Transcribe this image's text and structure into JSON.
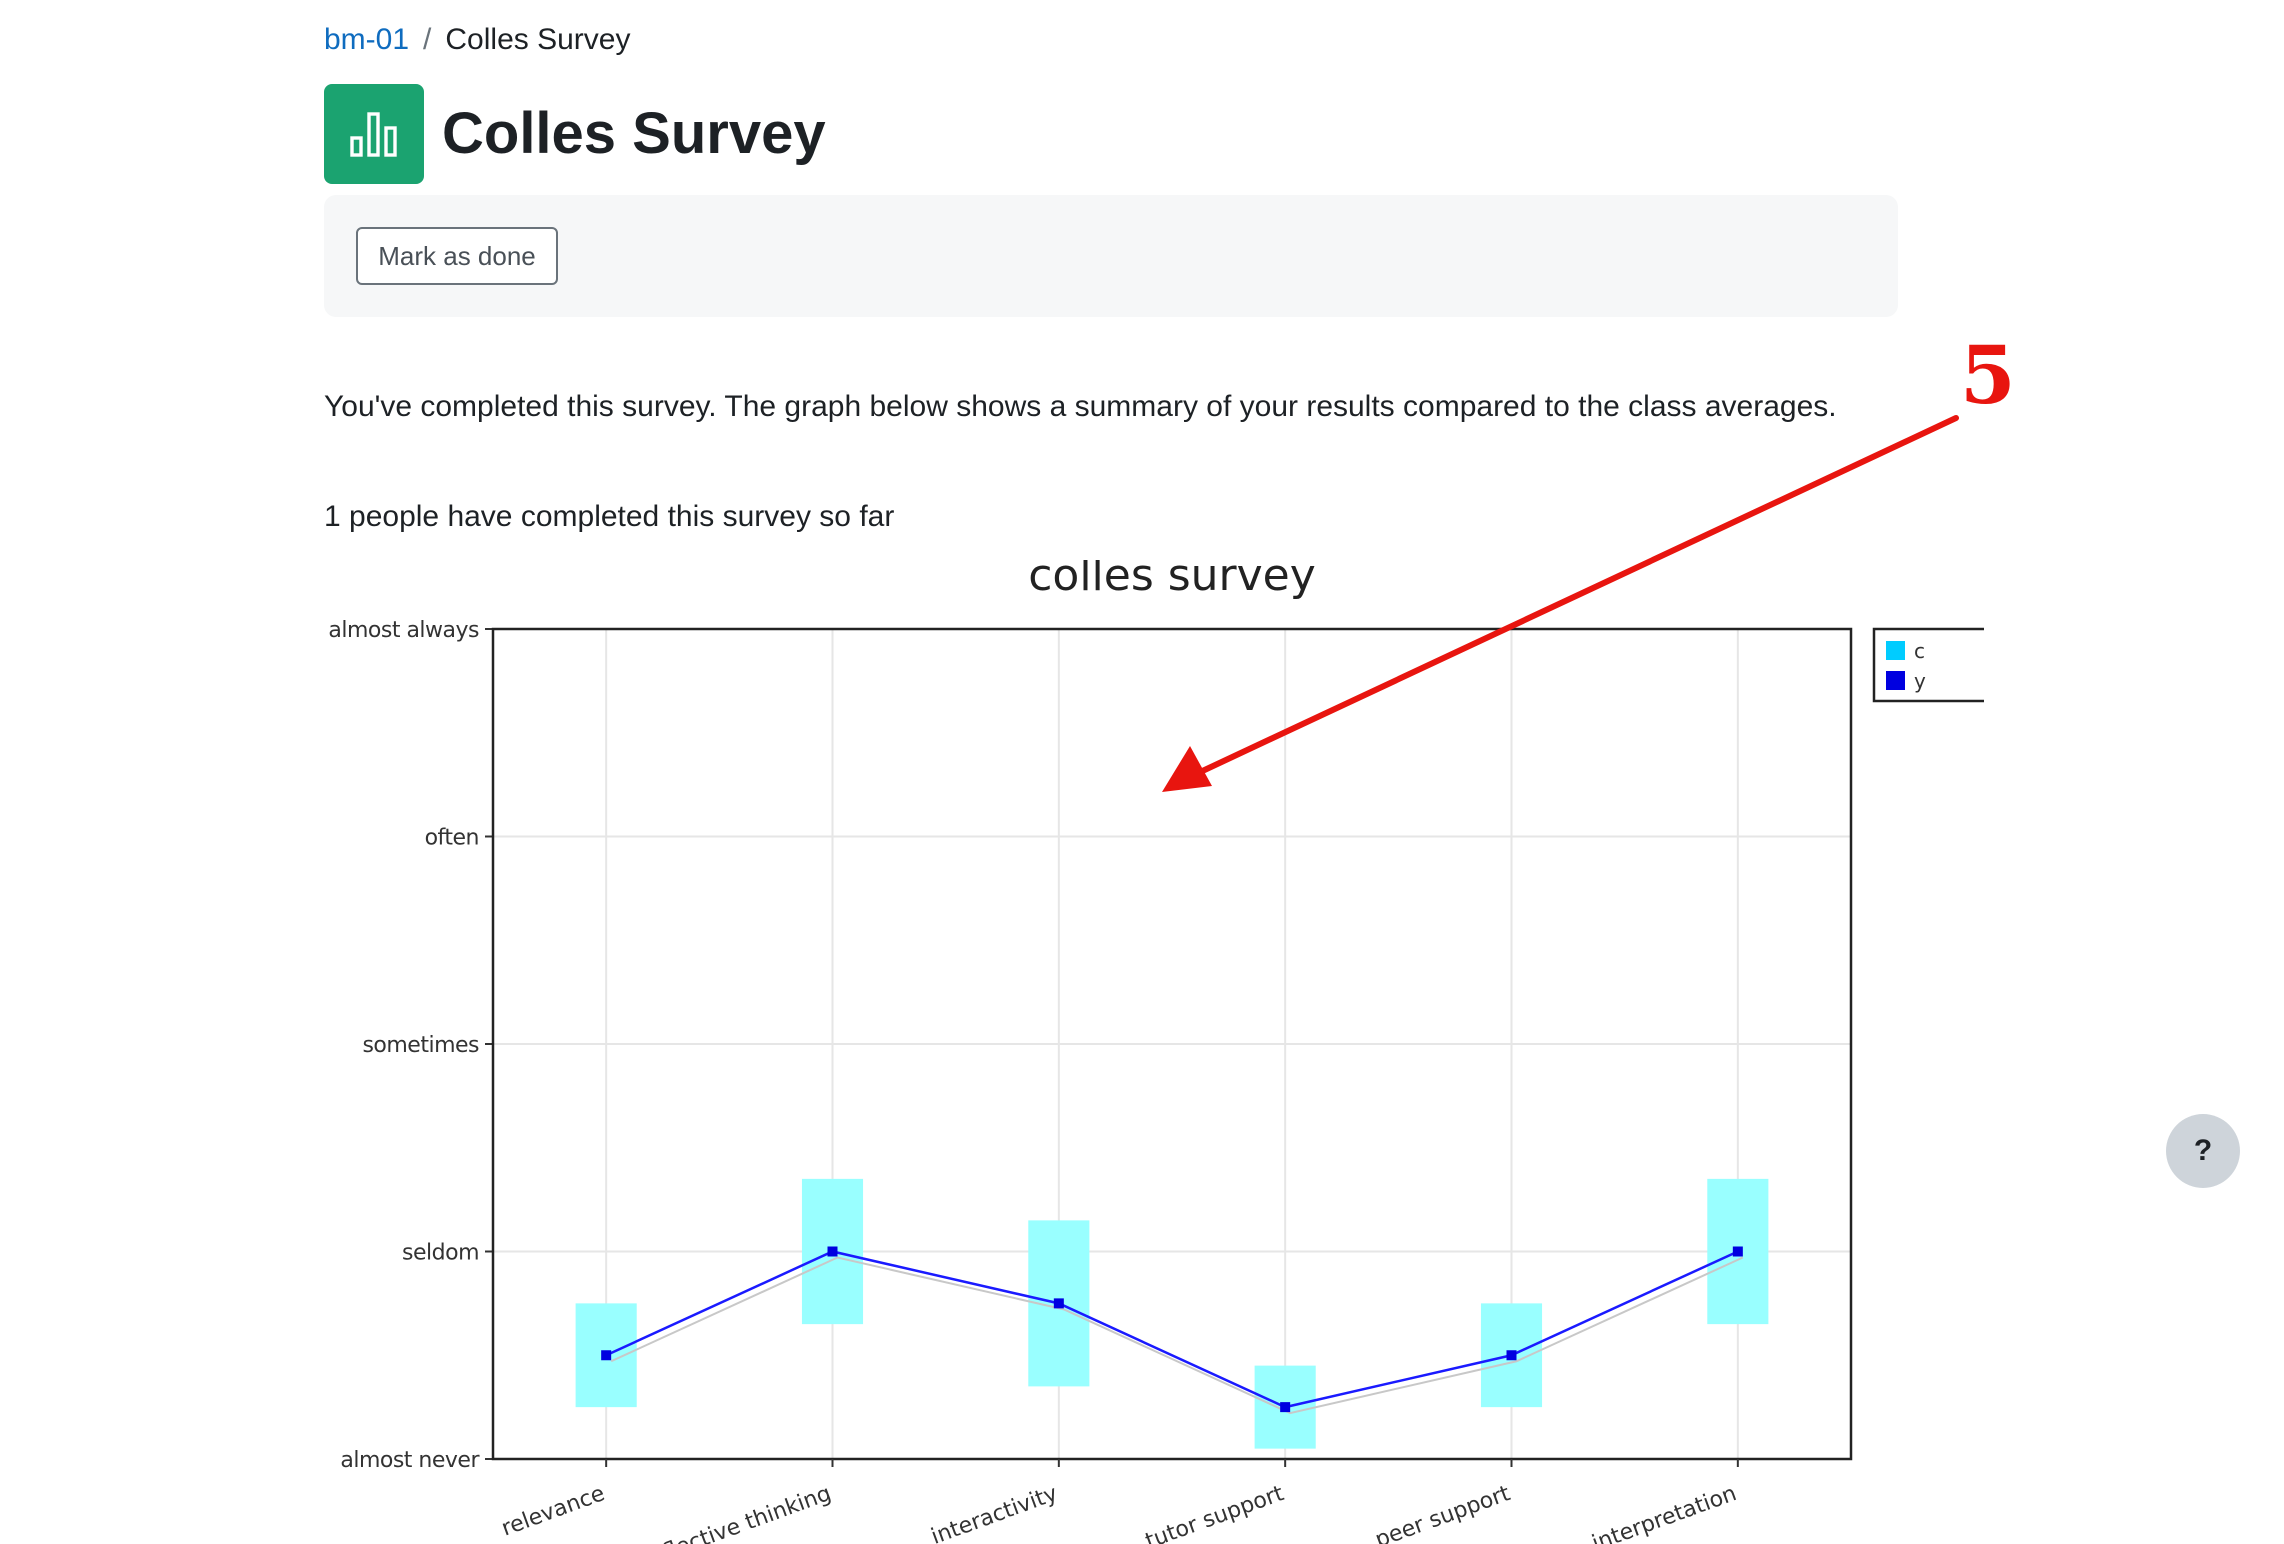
{
  "breadcrumb": {
    "course": "bm-01",
    "separator": "/",
    "current": "Colles Survey"
  },
  "page": {
    "title": "Colles Survey",
    "icon": "chart-bars-icon",
    "icon_color": "#1ba370"
  },
  "activity": {
    "mark_done_label": "Mark as done"
  },
  "content": {
    "completion_text": "You've completed this survey. The graph below shows a summary of your results compared to the class averages.",
    "count_text": "1 people have completed this survey so far"
  },
  "annotation": {
    "label": "5",
    "color": "#e8150f"
  },
  "help": {
    "label": "?"
  },
  "chart_data": {
    "type": "line",
    "title": "colles survey",
    "categories": [
      "relevance",
      "reflective thinking",
      "interactivity",
      "tutor support",
      "peer support",
      "interpretation"
    ],
    "y_labels": [
      "almost never",
      "seldom",
      "sometimes",
      "often",
      "almost always"
    ],
    "ylim": [
      1,
      5
    ],
    "grid": true,
    "legend_position": "right",
    "legend_entries": [
      "c",
      "y"
    ],
    "series": [
      {
        "type": "range",
        "color": "#99ffff",
        "low": [
          1.25,
          1.65,
          1.35,
          1.05,
          1.25,
          1.65
        ],
        "high": [
          1.75,
          2.35,
          2.15,
          1.45,
          1.75,
          2.35
        ]
      },
      {
        "type": "line",
        "color": "#1a1aff",
        "values": [
          1.5,
          2.0,
          1.75,
          1.25,
          1.5,
          2.0
        ]
      }
    ]
  }
}
